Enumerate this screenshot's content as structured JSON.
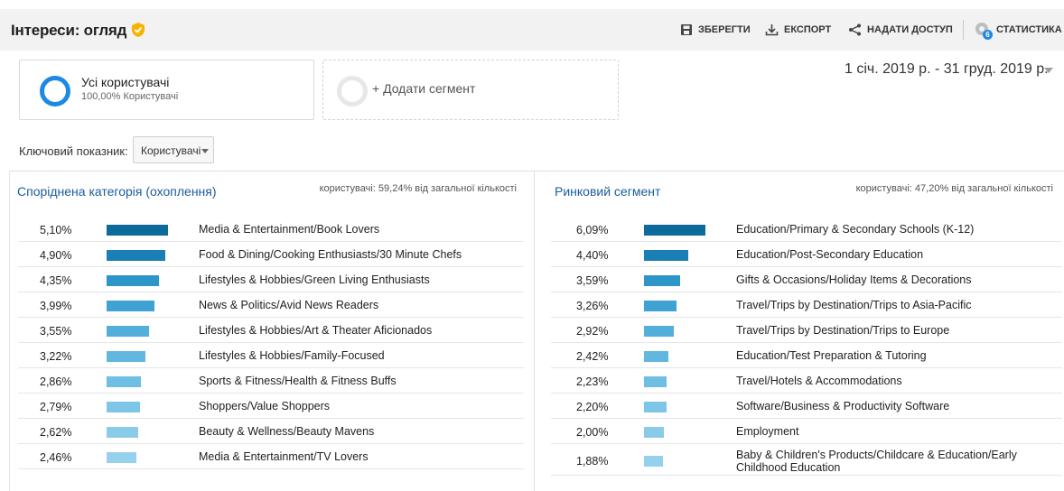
{
  "header": {
    "title": "Інтереси: огляд",
    "actions": {
      "save": "ЗБЕРЕГТИ",
      "export": "ЕКСПОРТ",
      "share": "НАДАТИ ДОСТУП",
      "insights": "СТАТИСТИКА",
      "insights_badge": "6"
    }
  },
  "segments": {
    "current": {
      "name": "Усі користувачі",
      "subtitle": "100,00% Користувачі",
      "color": "#1e88e5"
    },
    "add_label": "+ Додати сегмент"
  },
  "date_range": "1 січ. 2019 р. - 31 груд. 2019 р.",
  "key_metric": {
    "label": "Ключовий показник:",
    "value": "Користувачі"
  },
  "affinity": {
    "title": "Споріднена категорія (охоплення)",
    "note": "користувачі: 59,24% від загальної кількості",
    "rows": [
      {
        "pct": "5,10%",
        "value": 5.1,
        "category": "Media & Entertainment/Book Lovers"
      },
      {
        "pct": "4,90%",
        "value": 4.9,
        "category": "Food & Dining/Cooking Enthusiasts/30 Minute Chefs"
      },
      {
        "pct": "4,35%",
        "value": 4.35,
        "category": "Lifestyles & Hobbies/Green Living Enthusiasts"
      },
      {
        "pct": "3,99%",
        "value": 3.99,
        "category": "News & Politics/Avid News Readers"
      },
      {
        "pct": "3,55%",
        "value": 3.55,
        "category": "Lifestyles & Hobbies/Art & Theater Aficionados"
      },
      {
        "pct": "3,22%",
        "value": 3.22,
        "category": "Lifestyles & Hobbies/Family-Focused"
      },
      {
        "pct": "2,86%",
        "value": 2.86,
        "category": "Sports & Fitness/Health & Fitness Buffs"
      },
      {
        "pct": "2,79%",
        "value": 2.79,
        "category": "Shoppers/Value Shoppers"
      },
      {
        "pct": "2,62%",
        "value": 2.62,
        "category": "Beauty & Wellness/Beauty Mavens"
      },
      {
        "pct": "2,46%",
        "value": 2.46,
        "category": "Media & Entertainment/TV Lovers"
      }
    ]
  },
  "in_market": {
    "title": "Ринковий сегмент",
    "note": "користувачі: 47,20% від загальної кількості",
    "rows": [
      {
        "pct": "6,09%",
        "value": 6.09,
        "category": "Education/Primary & Secondary Schools (K-12)"
      },
      {
        "pct": "4,40%",
        "value": 4.4,
        "category": "Education/Post-Secondary Education"
      },
      {
        "pct": "3,59%",
        "value": 3.59,
        "category": "Gifts & Occasions/Holiday Items & Decorations"
      },
      {
        "pct": "3,26%",
        "value": 3.26,
        "category": "Travel/Trips by Destination/Trips to Asia-Pacific"
      },
      {
        "pct": "2,92%",
        "value": 2.92,
        "category": "Travel/Trips by Destination/Trips to Europe"
      },
      {
        "pct": "2,42%",
        "value": 2.42,
        "category": "Education/Test Preparation & Tutoring"
      },
      {
        "pct": "2,23%",
        "value": 2.23,
        "category": "Travel/Hotels & Accommodations"
      },
      {
        "pct": "2,20%",
        "value": 2.2,
        "category": "Software/Business & Productivity Software"
      },
      {
        "pct": "2,00%",
        "value": 2.0,
        "category": "Employment"
      },
      {
        "pct": "1,88%",
        "value": 1.88,
        "category": "Baby & Children's Products/Childcare & Education/Early Childhood Education"
      }
    ]
  },
  "bar_colors": [
    "#0c6b9a",
    "#1a7fb5",
    "#2e95c8",
    "#3fa2d3",
    "#52aedb",
    "#62b7df",
    "#6fbee3",
    "#7ec6e7",
    "#8acbea",
    "#95d0ec"
  ]
}
